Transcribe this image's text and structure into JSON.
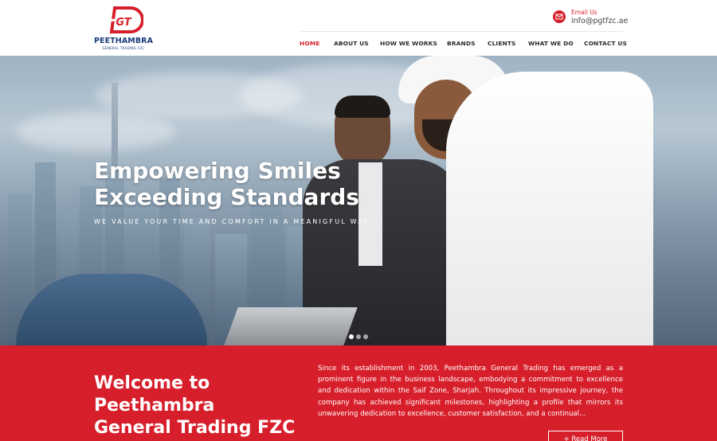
{
  "brand": {
    "logo_mark": "GT",
    "name": "PEETHAMBRA",
    "subtitle": "GENERAL TRADING FZC",
    "accent_color": "#d71f2b",
    "navy_color": "#1a3a7a"
  },
  "contact": {
    "icon": "email-icon",
    "label": "Email Us",
    "value": "info@pgtfzc.ae"
  },
  "nav": {
    "items": [
      {
        "label": "HOME",
        "active": true
      },
      {
        "label": "ABOUT US",
        "active": false
      },
      {
        "label": "HOW WE WORKS",
        "active": false
      },
      {
        "label": "BRANDS",
        "active": false
      },
      {
        "label": "CLIENTS",
        "active": false
      },
      {
        "label": "WHAT WE DO",
        "active": false
      },
      {
        "label": "CONTACT US",
        "active": false
      }
    ]
  },
  "hero": {
    "title_line1": "Empowering Smiles",
    "title_line2": "Exceeding Standards",
    "tagline": "WE VALUE YOUR TIME AND COMFORT IN A MEANIGFUL WAY...",
    "slide_count": 3,
    "active_slide": 1
  },
  "welcome": {
    "title_line1": "Welcome to",
    "title_line2": "Peethambra",
    "title_line3": "General Trading FZC",
    "body": "Since its establishment in 2003, Peethambra General Trading has emerged as a prominent figure in the business landscape, embodying a commitment to excellence and dedication within the Saif Zone, Sharjah. Throughout its impressive journey, the company has achieved significant milestones, highlighting a profile that mirrors its unwavering dedication to excellence, customer satisfaction, and a continual...",
    "button_label": "+ Read More"
  }
}
